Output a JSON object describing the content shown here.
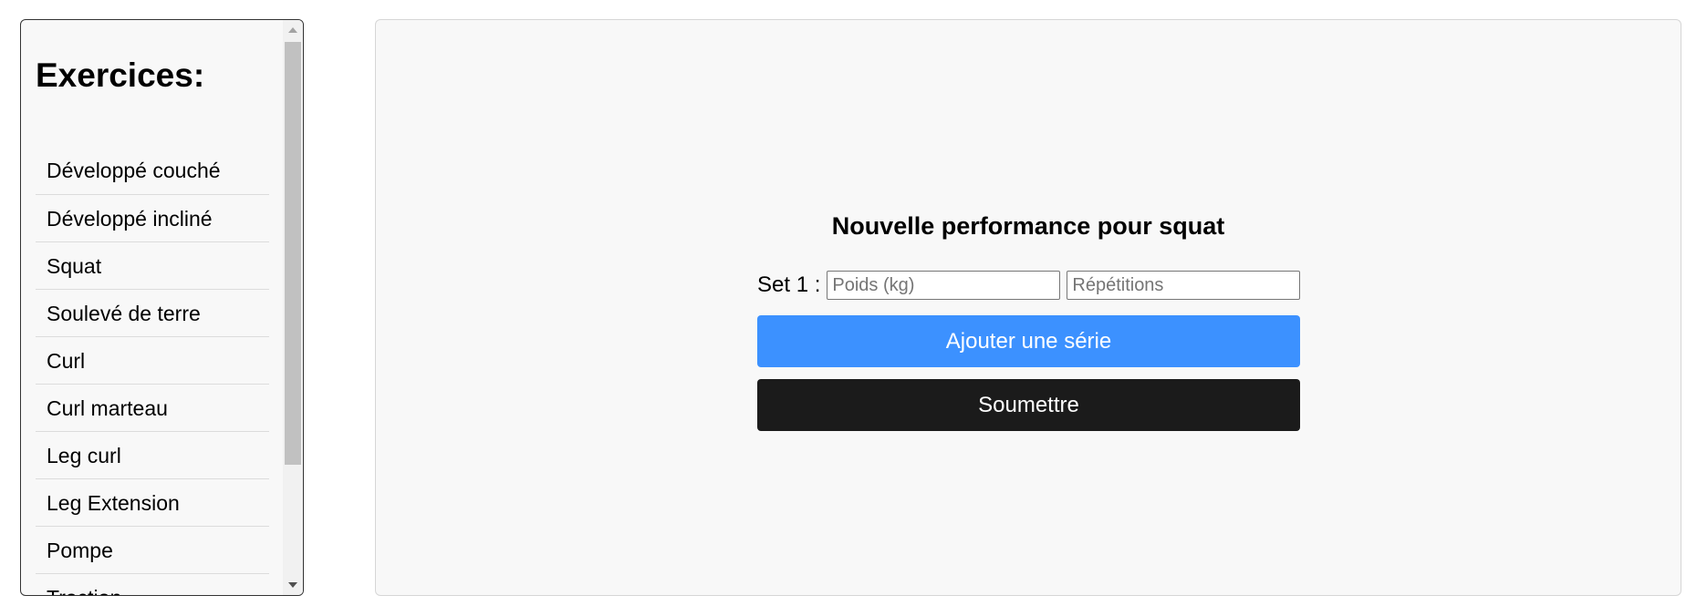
{
  "sidebar": {
    "title": "Exercices:",
    "items": [
      {
        "label": "Développé couché"
      },
      {
        "label": "Développé incliné"
      },
      {
        "label": "Squat"
      },
      {
        "label": "Soulevé de terre"
      },
      {
        "label": "Curl"
      },
      {
        "label": "Curl marteau"
      },
      {
        "label": "Leg curl"
      },
      {
        "label": "Leg Extension"
      },
      {
        "label": "Pompe"
      },
      {
        "label": "Traction"
      }
    ]
  },
  "form": {
    "title": "Nouvelle performance pour squat",
    "sets": [
      {
        "label": "Set 1 :",
        "weight_value": "",
        "weight_placeholder": "Poids (kg)",
        "reps_value": "",
        "reps_placeholder": "Répétitions"
      }
    ],
    "add_set_label": "Ajouter une série",
    "submit_label": "Soumettre"
  },
  "icons": {
    "scroll_up": "chevron-up-icon",
    "scroll_down": "chevron-down-icon"
  },
  "colors": {
    "add_button": "#3c91ff",
    "submit_button": "#1b1b1b",
    "panel_background": "#f8f8f8"
  }
}
